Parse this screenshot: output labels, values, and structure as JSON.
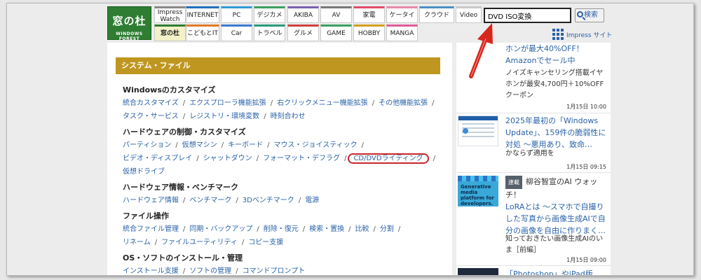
{
  "header": {
    "logo_title": "窓の杜",
    "logo_sub": "WINDOWS FOREST",
    "nav_row1": [
      {
        "label": "Impress\nWatch",
        "line1": "Impress",
        "line2": "Watch",
        "color": "#888888"
      },
      {
        "label": "INTERNET",
        "color": "#1f6fbf"
      },
      {
        "label": "PC",
        "color": "#2e9ad6"
      },
      {
        "label": "デジカメ",
        "color": "#3aa060"
      },
      {
        "label": "AKIBA",
        "color": "#7a5fb0"
      },
      {
        "label": "AV",
        "color": "#777777"
      },
      {
        "label": "家電",
        "color": "#e04a6a"
      },
      {
        "label": "ケータイ",
        "color": "#e88aa8"
      },
      {
        "label": "クラウド",
        "color": "#4a90c2"
      },
      {
        "label": "Video",
        "color": "#c9c9c9"
      }
    ],
    "nav_row2": [
      {
        "label": "窓の杜",
        "color": "#2e7d32"
      },
      {
        "label": "こどもとIT",
        "color": "#e07a2a"
      },
      {
        "label": "Car",
        "color": "#3a7bd0"
      },
      {
        "label": "トラベル",
        "color": "#2a9a7a"
      },
      {
        "label": "グルメ",
        "color": "#d04040"
      },
      {
        "label": "GAME",
        "color": "#3aa060"
      },
      {
        "label": "HOBBY",
        "color": "#d4a020"
      },
      {
        "label": "MANGA",
        "color": "#e05a9a"
      }
    ],
    "search_value": "DVD ISO変換",
    "search_button": "検索",
    "impress_site": "Impress サイト"
  },
  "main": {
    "section_title": "システム・ファイル",
    "categories": [
      {
        "title": "Windowsのカスタマイズ",
        "rows": [
          [
            "統合カスタマイズ",
            "エクスプローラ機能拡張",
            "右クリックメニュー機能拡張",
            "その他機能拡張"
          ],
          [
            "タスク・サービス",
            "レジストリ・環境変数",
            "時刻合わせ"
          ]
        ]
      },
      {
        "title": "ハードウェアの制御・カスタマイズ",
        "rows": [
          [
            "パーティション",
            "仮想マシン",
            "キーボード",
            "マウス・ジョイスティック"
          ],
          [
            "ビデオ・ディスプレイ",
            "シャットダウン",
            "フォーマット・デフラグ",
            "CD/DVDライティング"
          ],
          [
            "仮想ドライブ"
          ]
        ]
      },
      {
        "title": "ハードウェア情報・ベンチマーク",
        "rows": [
          [
            "ハードウェア情報",
            "ベンチマーク",
            "3Dベンチマーク",
            "電源"
          ]
        ]
      },
      {
        "title": "ファイル操作",
        "rows": [
          [
            "統合ファイル管理",
            "同期・バックアップ",
            "削除・復元",
            "検索・置換",
            "比較",
            "分割"
          ],
          [
            "リネーム",
            "ファイルユーティリティ",
            "コピー支援"
          ]
        ]
      },
      {
        "title": "OS・ソフトのインストール・管理",
        "rows": [
          [
            "インストール支援",
            "ソフトの管理",
            "コマンドプロンプト"
          ]
        ]
      }
    ]
  },
  "sidebar": {
    "article0": {
      "text": "ホンが最大40%OFF！Amazonでセール中",
      "sub": "ノイズキャンセリング搭載イヤホンが最安4,700円＋10%OFFクーポン",
      "date": "1月15日 10:00"
    },
    "article1": {
      "text": "2025年最初の「Windows Update」、159件の脆弱性に対処 ～悪用あり、致命…",
      "sub": "かならず適用を",
      "date": "1月15日 09:15"
    },
    "article2": {
      "badge": "連載",
      "text_top": "柳谷智宣のAI ウォッチ！",
      "text": "LoRAとは ～スマホで自撮りした写真から画像生成AIで自分の画像を自由に作りまく…",
      "sub": "知っておきたい画像生成AIのいま［前編］",
      "date": "1月15日 09:00"
    },
    "article3": {
      "text": "「Photoshop」やiPad版…"
    },
    "thumb_text": "Generative media platform for developers."
  }
}
